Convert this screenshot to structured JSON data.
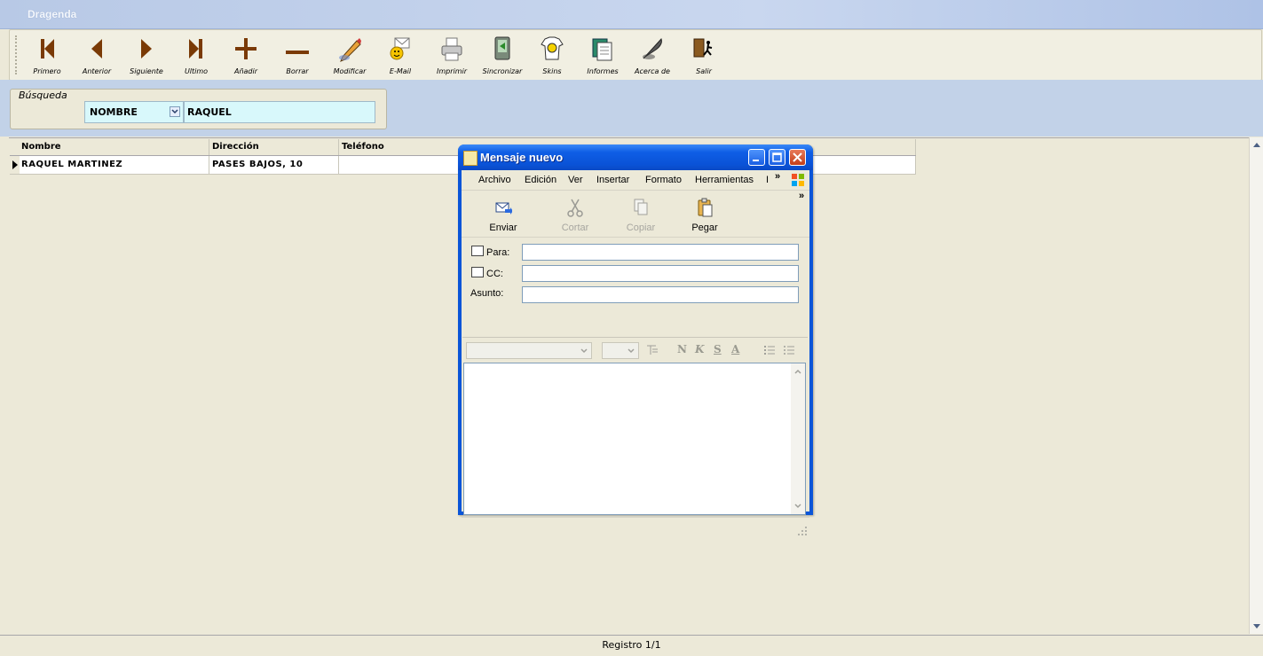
{
  "window": {
    "title": "Dragenda"
  },
  "toolbar": {
    "items": [
      {
        "label": "Primero",
        "icon": "first-record-icon"
      },
      {
        "label": "Anterior",
        "icon": "previous-record-icon"
      },
      {
        "label": "Siguiente",
        "icon": "next-record-icon"
      },
      {
        "label": "Ultimo",
        "icon": "last-record-icon"
      },
      {
        "label": "Añadir",
        "icon": "add-icon"
      },
      {
        "label": "Borrar",
        "icon": "delete-icon"
      },
      {
        "label": "Modificar",
        "icon": "edit-pencil-icon"
      },
      {
        "label": "E-Mail",
        "icon": "email-icon"
      },
      {
        "label": "Imprimir",
        "icon": "printer-icon"
      },
      {
        "label": "Sincronizar",
        "icon": "sync-device-icon"
      },
      {
        "label": "Skins",
        "icon": "skins-shirt-icon"
      },
      {
        "label": "Informes",
        "icon": "reports-icon"
      },
      {
        "label": "Acerca de",
        "icon": "about-quill-icon"
      },
      {
        "label": "Salir",
        "icon": "exit-door-icon"
      }
    ]
  },
  "search": {
    "legend": "Búsqueda",
    "field": "NOMBRE",
    "value": "RAQUEL"
  },
  "grid": {
    "columns": [
      "Nombre",
      "Dirección",
      "Teléfono"
    ],
    "rows": [
      {
        "nombre": "RAQUEL MARTINEZ",
        "direccion": "PASES BAJOS, 10",
        "telefono": ""
      }
    ]
  },
  "status": {
    "text": "Registro 1/1"
  },
  "dialog": {
    "title": "Mensaje nuevo",
    "menu": [
      "Archivo",
      "Edición",
      "Ver",
      "Insertar",
      "Formato",
      "Herramientas",
      "I"
    ],
    "menu_more": "»",
    "tools": [
      {
        "label": "Enviar",
        "icon": "send-icon",
        "enabled": true
      },
      {
        "label": "Cortar",
        "icon": "scissors-icon",
        "enabled": false
      },
      {
        "label": "Copiar",
        "icon": "copy-icon",
        "enabled": false
      },
      {
        "label": "Pegar",
        "icon": "paste-icon",
        "enabled": true
      }
    ],
    "tools_more": "»",
    "fields": {
      "to_label": "Para:",
      "cc_label": "CC:",
      "subject_label": "Asunto:",
      "to_value": "",
      "cc_value": "",
      "subject_value": ""
    },
    "format_glyphs": [
      "N",
      "K",
      "S",
      "A"
    ]
  }
}
